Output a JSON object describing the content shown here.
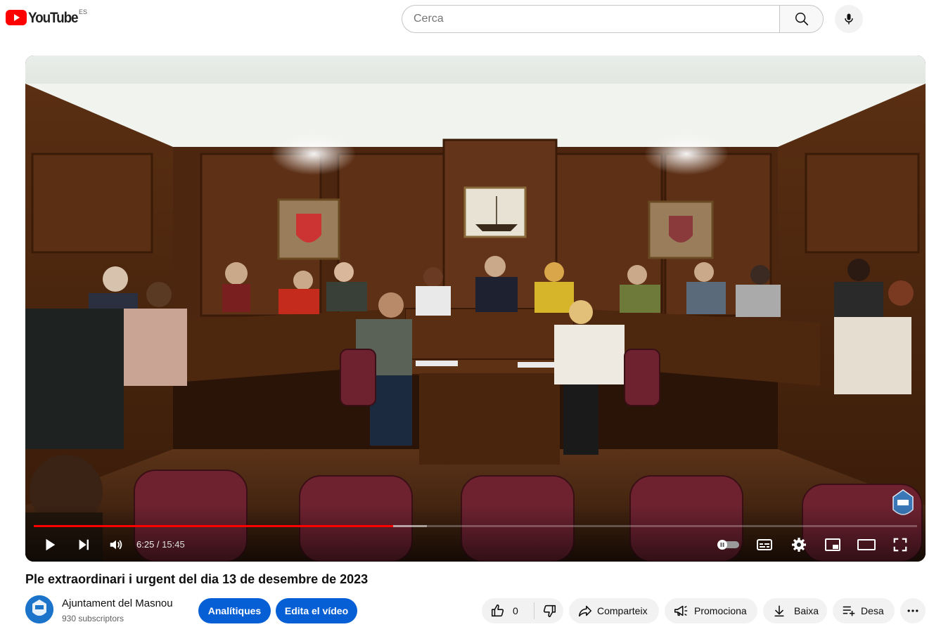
{
  "header": {
    "logo_text": "YouTube",
    "country_code": "ES",
    "search_placeholder": "Cerca",
    "search_icon": "search-icon",
    "mic_icon": "microphone-icon"
  },
  "player": {
    "current_time": "6:25",
    "duration": "15:45",
    "time_separator": " / ",
    "played_fraction": 0.407,
    "loaded_fraction": 0.445,
    "accent_color": "#ff0000",
    "icons": [
      "play-icon",
      "next-icon",
      "volume-icon",
      "autoplay-toggle-icon",
      "subtitles-icon",
      "settings-icon",
      "miniplayer-icon",
      "theater-mode-icon",
      "fullscreen-icon"
    ]
  },
  "video": {
    "title": "Ple extraordinari i urgent del dia 13 de desembre de 2023"
  },
  "channel": {
    "name": "Ajuntament del Masnou",
    "subscribers": "930 subscriptors"
  },
  "actions": {
    "analytics_label": "Analítiques",
    "edit_label": "Edita el vídeo",
    "like_count": "0",
    "share_label": "Comparteix",
    "promote_label": "Promociona",
    "download_label": "Baixa",
    "save_label": "Desa",
    "brand_color": "#065fd4"
  }
}
